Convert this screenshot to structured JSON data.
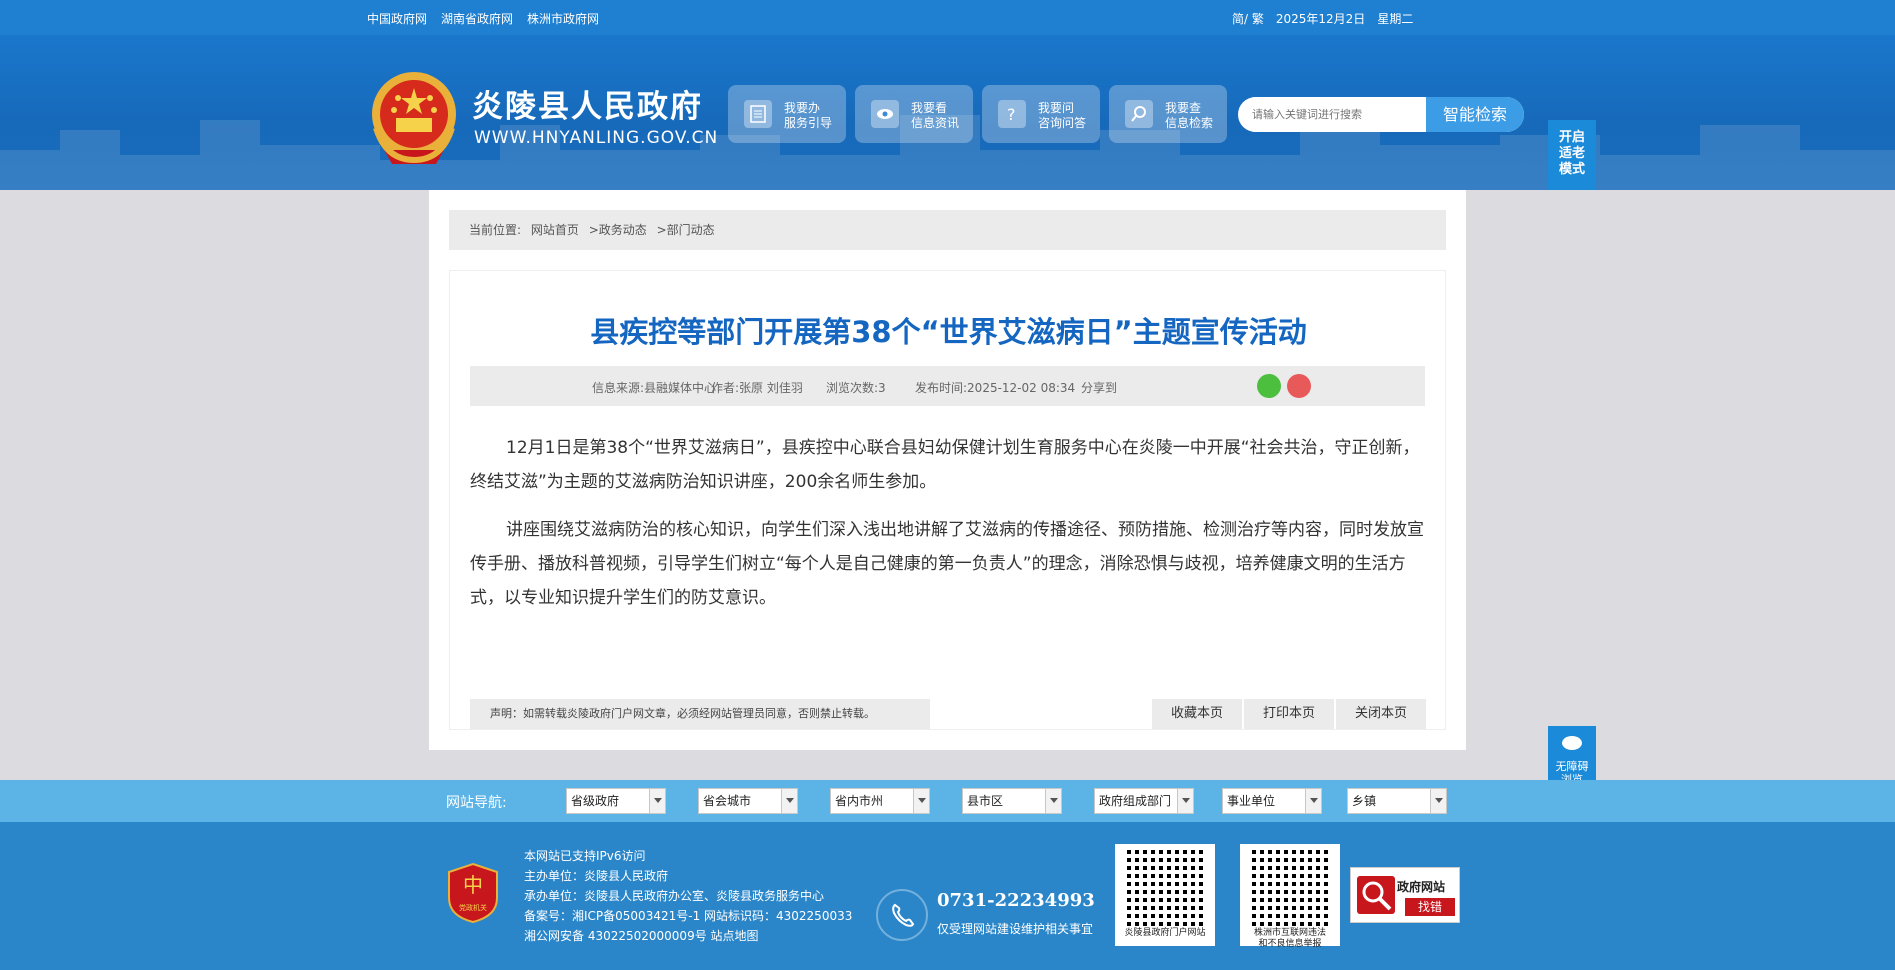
{
  "topbar": {
    "links": [
      "中国政府网",
      "湖南省政府网",
      "株洲市政府网"
    ],
    "lang": "简/ 繁",
    "date": "2025年12月2日",
    "weekday": "星期二"
  },
  "header": {
    "site_name": "炎陵县人民政府",
    "site_domain": "WWW.HNYANLING.GOV.CN",
    "services": [
      {
        "line1": "我要办",
        "line2": "服务引导",
        "icon": "document-icon"
      },
      {
        "line1": "我要看",
        "line2": "信息资讯",
        "icon": "eye-icon"
      },
      {
        "line1": "我要问",
        "line2": "咨询问答",
        "icon": "question-icon"
      },
      {
        "line1": "我要查",
        "line2": "信息检索",
        "icon": "search-icon"
      }
    ],
    "search_placeholder": "请输入关键词进行搜索",
    "search_button": "智能检索",
    "elder_mode": "开启适老模式"
  },
  "breadcrumb": {
    "prefix": "当前位置:",
    "items": [
      "网站首页",
      ">政务动态",
      ">部门动态"
    ]
  },
  "article": {
    "title": "县疾控等部门开展第38个“世界艾滋病日”主题宣传活动",
    "source": "信息来源:县融媒体中心",
    "author": "作者:张原 刘佳羽",
    "views": "浏览次数:3",
    "published": "发布时间:2025-12-02 08:34",
    "share_label": "分享到",
    "paragraphs": [
      "12月1日是第38个“世界艾滋病日”，县疾控中心联合县妇幼保健计划生育服务中心在炎陵一中开展“社会共治，守正创新，终结艾滋”为主题的艾滋病防治知识讲座，200余名师生参加。",
      "讲座围绕艾滋病防治的核心知识，向学生们深入浅出地讲解了艾滋病的传播途径、预防措施、检测治疗等内容，同时发放宣传手册、播放科普视频，引导学生们树立“每个人是自己健康的第一负责人”的理念，消除恐惧与歧视，培养健康文明的生活方式，以专业知识提升学生们的防艾意识。"
    ],
    "notice": "声明：如需转载炎陵政府门户网文章，必须经网站管理员同意，否则禁止转载。",
    "actions": [
      "收藏本页",
      "打印本页",
      "关闭本页"
    ]
  },
  "accessibility": {
    "label_line1": "无障碍",
    "label_line2": "浏览"
  },
  "site_nav": {
    "label": "网站导航:",
    "selects": [
      "省级政府",
      "省会城市",
      "省内市州",
      "县市区",
      "政府组成部门",
      "事业单位",
      "乡镇"
    ]
  },
  "footer": {
    "info_lines": [
      "本网站已支持IPv6访问",
      "主办单位：炎陵县人民政府",
      "承办单位：炎陵县人民政府办公室、炎陵县政务服务中心",
      "备案号：湘ICP备05003421号-1 网站标识码：4302250033",
      "湘公网安备 43022502000009号 站点地图"
    ],
    "phone": "0731-22234993",
    "phone_note": "仅受理网站建设维护相关事宜",
    "qr1_caption": "炎陵县政府门户网站",
    "qr2_caption_line1": "株洲市互联网违法",
    "qr2_caption_line2": "和不良信息举报",
    "report_line1": "政府网站",
    "report_line2": "找错",
    "badge_text": "党政机关"
  },
  "colors": {
    "brand_blue": "#1f7fd0",
    "title_blue": "#1466c0",
    "nav_strip": "#5bb3e6",
    "footer": "#2a86c9"
  }
}
